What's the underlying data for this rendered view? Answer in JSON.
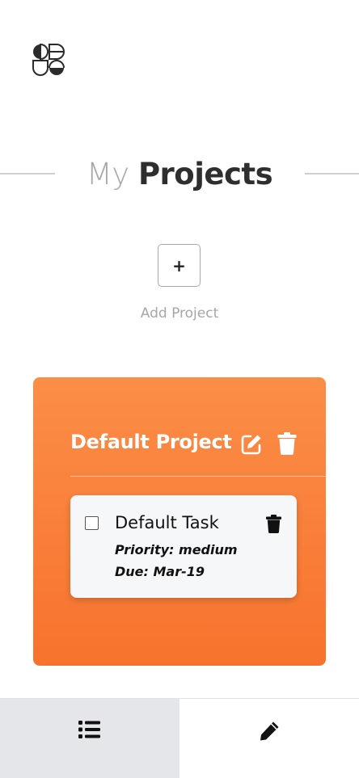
{
  "app": {
    "logo_icon": "logo-icon"
  },
  "header": {
    "title_light": "My",
    "title_bold": "Projects"
  },
  "add_project": {
    "button_label": "+",
    "label": "Add Project"
  },
  "projects": [
    {
      "name": "Default Project",
      "edit_icon": "edit-icon",
      "delete_icon": "trash-icon",
      "accent": "#f98a44",
      "tasks": [
        {
          "title": "Default Task",
          "checked": false,
          "priority_label": "Priority:",
          "priority_value": "medium",
          "due_label": "Due:",
          "due_value": "Mar-19",
          "delete_icon": "trash-icon"
        }
      ]
    }
  ],
  "bottom_nav": {
    "tabs": [
      {
        "icon": "list-icon",
        "active": true
      },
      {
        "icon": "pencil-icon",
        "active": false
      }
    ],
    "active_bg": "#e5e6e9"
  }
}
